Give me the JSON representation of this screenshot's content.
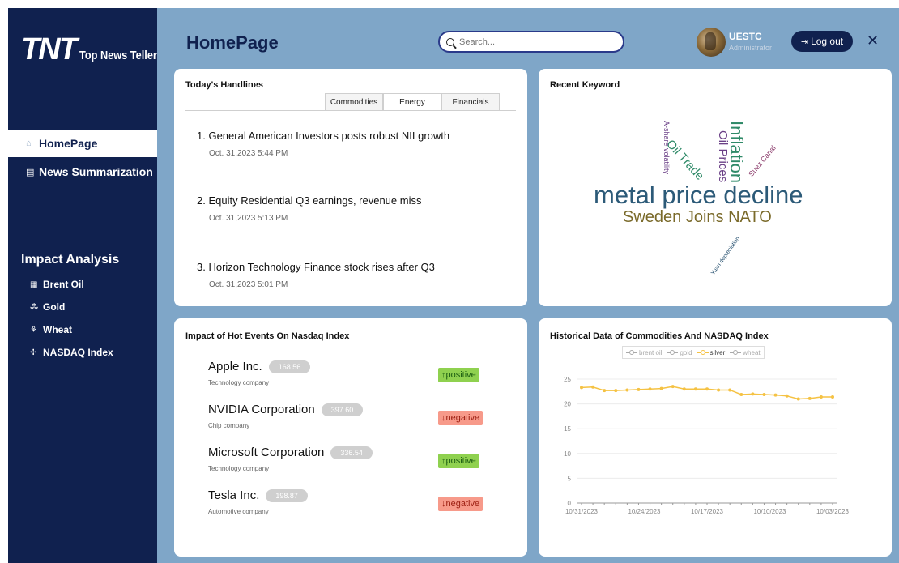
{
  "app": {
    "logo_big": "TNT",
    "logo_small": "Top News Teller",
    "page_title": "HomePage"
  },
  "sidebar": {
    "nav": [
      {
        "label": "HomePage",
        "icon": "home-icon",
        "active": true
      },
      {
        "label": "News Summarization",
        "icon": "newspaper-icon",
        "active": false
      }
    ],
    "section_title": "Impact Analysis",
    "sub": [
      {
        "label": "Brent Oil",
        "icon": "oil-barrel-icon"
      },
      {
        "label": "Gold",
        "icon": "gold-bars-icon"
      },
      {
        "label": "Wheat",
        "icon": "wheat-icon"
      },
      {
        "label": "NASDAQ Index",
        "icon": "chart-icon"
      }
    ]
  },
  "header": {
    "search_placeholder": "Search...",
    "user_name": "UESTC",
    "user_role": "Administrator",
    "logout_label": "Log out",
    "close_label": "✕"
  },
  "headlines": {
    "title": "Today's Handlines",
    "tabs": [
      "Commodities",
      "Energy",
      "Financials"
    ],
    "selected_tab": "Energy",
    "items": [
      {
        "title": "1. General American Investors posts robust NII growth",
        "date": "Oct. 31,2023 5:44 PM"
      },
      {
        "title": "2. Equity Residential Q3 earnings, revenue miss",
        "date": "Oct. 31,2023 5:13 PM"
      },
      {
        "title": "3. Horizon Technology Finance stock rises after Q3",
        "date": "Oct. 31,2023 5:01 PM"
      }
    ]
  },
  "keywords": {
    "title": "Recent Keyword",
    "words": [
      {
        "text": "metal price decline",
        "color": "#2c5a78"
      },
      {
        "text": "Sweden Joins NATO",
        "color": "#7a6a2a"
      },
      {
        "text": "Inflation",
        "color": "#2f8a68"
      },
      {
        "text": "Oil Prices",
        "color": "#6a3f86"
      },
      {
        "text": "Oil Trade",
        "color": "#2f8a68"
      },
      {
        "text": "A-share volatility",
        "color": "#6a3f86"
      },
      {
        "text": "Suez Canal",
        "color": "#8a3a6a"
      },
      {
        "text": "Yuan depreciation",
        "color": "#1e4a6a"
      }
    ]
  },
  "impact": {
    "title": "Impact of Hot Events On Nasdaq Index",
    "companies": [
      {
        "name": "Apple Inc.",
        "price": "168.56",
        "desc": "Technology company",
        "sentiment": "↑positive",
        "positive": true
      },
      {
        "name": "NVIDIA Corporation",
        "price": "397.60",
        "desc": "Chip company",
        "sentiment": "↓negative",
        "positive": false
      },
      {
        "name": "Microsoft Corporation",
        "price": "336.54",
        "desc": "Technology company",
        "sentiment": "↑positive",
        "positive": true
      },
      {
        "name": "Tesla Inc.",
        "price": "198.87",
        "desc": "Automotive company",
        "sentiment": "↓negative",
        "positive": false
      }
    ]
  },
  "chart_data": {
    "type": "line",
    "title": "Historical Data of Commodities And NASDAQ Index",
    "legend": [
      "brent oil",
      "gold",
      "silver",
      "wheat"
    ],
    "active_series": "silver",
    "legend_placement": "top",
    "colors": {
      "inactive": "#aaaaaa",
      "silver": "#f5c243"
    },
    "x_tick_labels": [
      "10/31/2023",
      "10/24/2023",
      "10/17/2023",
      "10/10/2023",
      "10/03/2023"
    ],
    "y_ticks": [
      0,
      5,
      10,
      15,
      20,
      25
    ],
    "ylim": [
      0,
      25
    ],
    "series": [
      {
        "name": "silver",
        "values": [
          23.3,
          23.4,
          22.7,
          22.7,
          22.8,
          22.9,
          23.0,
          23.1,
          23.5,
          23.0,
          23.0,
          23.0,
          22.8,
          22.8,
          21.9,
          22.0,
          21.9,
          21.8,
          21.6,
          21.0,
          21.1,
          21.4,
          21.4
        ]
      }
    ]
  }
}
